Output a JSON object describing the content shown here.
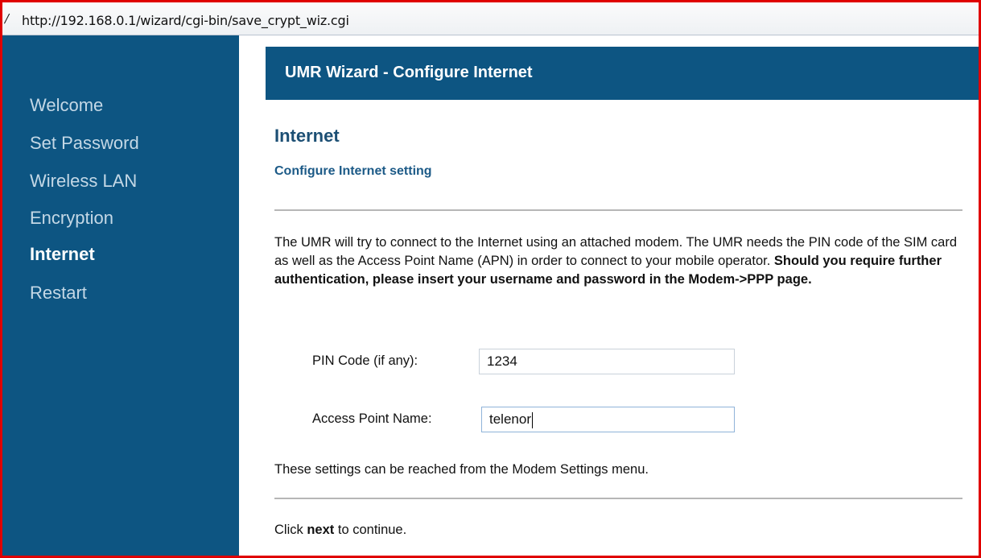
{
  "browser": {
    "url": "http://192.168.0.1/wizard/cgi-bin/save_crypt_wiz.cgi",
    "url_glyph": "/"
  },
  "sidebar": {
    "items": [
      {
        "label": "Welcome",
        "active": false
      },
      {
        "label": "Set Password",
        "active": false
      },
      {
        "label": "Wireless LAN",
        "active": false
      },
      {
        "label": "Encryption",
        "active": false
      },
      {
        "label": "Internet",
        "active": true
      },
      {
        "label": "Restart",
        "active": false
      }
    ]
  },
  "header": {
    "title": "UMR Wizard - Configure Internet"
  },
  "main": {
    "heading": "Internet",
    "subheading": "Configure Internet setting",
    "description_plain": "The UMR will try to connect to the Internet using an attached modem. The UMR needs the PIN code of the SIM card as well as the Access Point Name (APN) in order to connect to your mobile operator.",
    "description_bold": "Should you require further authentication, please insert your username and password in the Modem->PPP page.",
    "pin_label": "PIN Code (if any):",
    "pin_value": "1234",
    "apn_label": "Access Point Name:",
    "apn_value": "telenor",
    "note": "These settings can be reached from the Modem Settings menu.",
    "continue_prefix": "Click",
    "continue_bold": "next",
    "continue_suffix": "to continue."
  },
  "colors": {
    "brand": "#0d5582",
    "heading": "#1c4f74",
    "frame_highlight": "#e00000"
  }
}
